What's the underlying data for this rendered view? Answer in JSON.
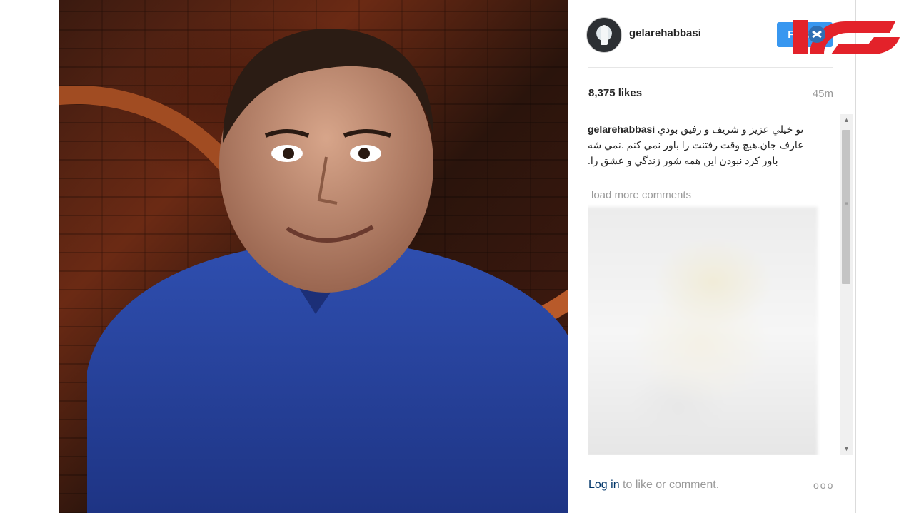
{
  "post": {
    "username": "gelarehabbasi",
    "follow_label": "Follow",
    "likes": "8,375 likes",
    "time_ago": "45m",
    "caption_user": "gelarehabbasi",
    "caption_text": "تو خيلي عزيز و شريف و رفيق بودي عارف جان.هيچ وقت رفتنت را باور نمي کنم .نمي شه باور کرد نبودن اين همه شور زندگي و عشق را.",
    "load_more": "load more comments",
    "footer_login": "Log in",
    "footer_rest": " to like or comment.",
    "more_icon": "ooo"
  },
  "colors": {
    "follow_bg": "#3897f0",
    "logo_red": "#e3222a",
    "logo_blue": "#2f6fb3"
  }
}
